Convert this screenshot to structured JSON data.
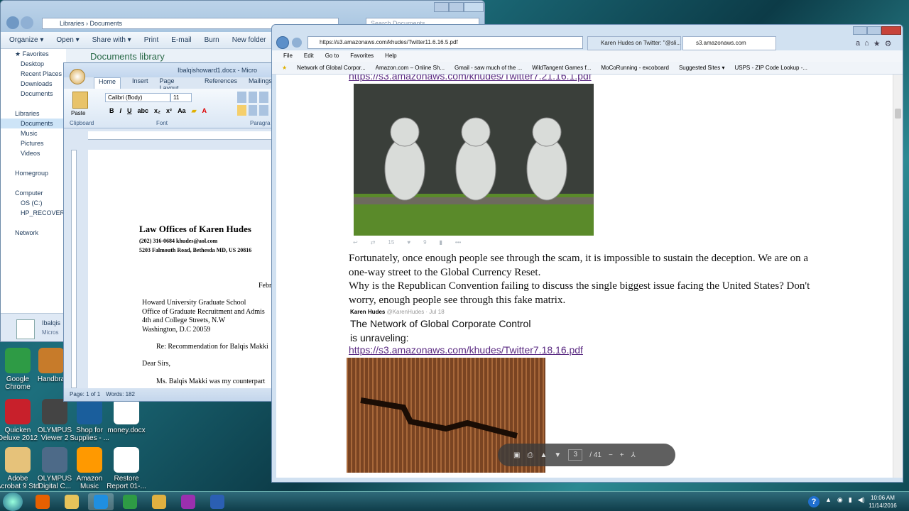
{
  "explorer": {
    "address": "Libraries › Documents",
    "search_placeholder": "Search Documents",
    "commands": [
      "Organize ▾",
      "Open ▾",
      "Share with ▾",
      "Print",
      "E-mail",
      "Burn",
      "New folder"
    ],
    "nav": [
      "★ Favorites",
      "Desktop",
      "Recent Places",
      "Downloads",
      "Documents",
      "",
      "Libraries",
      "Documents",
      "Music",
      "Pictures",
      "Videos",
      "",
      "Homegroup",
      "",
      "Computer",
      "OS (C:)",
      "HP_RECOVERY",
      "",
      "Network"
    ],
    "library_title": "Documents library",
    "details_name": "Ibalqis",
    "details_type": "Micros"
  },
  "word": {
    "title": "Ibalqishoward1.docx - Micro",
    "tabs": [
      "Home",
      "Insert",
      "Page Layout",
      "References",
      "Mailings"
    ],
    "font_name": "Calibri (Body)",
    "font_size": "11",
    "groups": [
      "Clipboard",
      "Font",
      "Paragra"
    ],
    "paste": "Paste",
    "letterhead": "Law Offices of Karen Hudes",
    "phone_line": "(202) 316-0684    khudes@aol.com",
    "address_line": "5203 Falmouth Road, Bethesda MD, US 20816",
    "date": "Febr",
    "recipient": [
      "Howard University Graduate School",
      "Office of Graduate Recruitment and Admis",
      "4th and College Streets, N.W",
      "Washington, D.C 20059"
    ],
    "re": "Re: Recommendation for Balqis Makki",
    "salutation": "Dear Sirs,",
    "body": "Ms. Balqis Makki was my counterpart",
    "status_page": "Page: 1 of 1",
    "status_words": "Words: 182"
  },
  "browser": {
    "url": "https://s3.amazonaws.com/khudes/Twitter11.6.16.5.pdf",
    "tabs": [
      "Karen Hudes on Twitter: \"@sli...",
      "s3.amazonaws.com"
    ],
    "menu": [
      "File",
      "Edit",
      "Go to",
      "Favorites",
      "Help"
    ],
    "favorites": [
      "Network of Global Corpor...",
      "Amazon.com – Online Sh...",
      "Gmail - saw much of the ...",
      "WildTangent Games f...",
      "MoCoRunning - excoboard",
      "Suggested Sites ▾",
      "USPS - ZIP Code Lookup -..."
    ],
    "link_top": "https://s3.amazonaws.com/khudes/Twitter7.21.16.1.pdf",
    "tweet_stats": [
      "15",
      "9"
    ],
    "paragraph1": "Fortunately, once enough people see through the scam, it is impossible to sustain the deception.  We are on a one-way street to the Global Currency Reset.",
    "paragraph2": "Why is the Republican Convention failing to discuss the single biggest issue facing the United States?  Don't worry, enough people see through this fake matrix.",
    "tweet_author": "Karen Hudes",
    "tweet_handle": "@KarenHudes · Jul 18",
    "tweet_line1": "The Network of Global Corporate Control",
    "tweet_line2": "is unraveling:",
    "link_bottom": "https://s3.amazonaws.com/khudes/Twitter7.18.16.pdf",
    "pdf_page": "3",
    "pdf_total": "/ 41"
  },
  "desktop_icons": [
    {
      "label": "Google Chrome",
      "color": "#2e9b45"
    },
    {
      "label": "Handbra",
      "color": "#c77b2a"
    },
    {
      "label": "Quicken Deluxe 2012",
      "color": "#c8202b"
    },
    {
      "label": "OLYMPUS Viewer 2",
      "color": "#444"
    },
    {
      "label": "Shop for Supplies - ...",
      "color": "#1a5e9c"
    },
    {
      "label": "money.docx",
      "color": "#ffffff"
    },
    {
      "label": "Adobe Acrobat 9 Std",
      "color": "#e6c27a"
    },
    {
      "label": "OLYMPUS Digital C...",
      "color": "#4d6a88"
    },
    {
      "label": "Amazon Music",
      "color": "#ff9900"
    },
    {
      "label": "Restore Report 01-...",
      "color": "#ffffff"
    }
  ],
  "taskbar": {
    "time": "10:06 AM",
    "date": "11/14/2016",
    "apps": [
      {
        "name": "firefox-icon",
        "color": "#e66000"
      },
      {
        "name": "folder-icon",
        "color": "#e7c35a"
      },
      {
        "name": "ie-icon",
        "color": "#1f8fe0"
      },
      {
        "name": "chrome-icon",
        "color": "#2e9b45"
      },
      {
        "name": "media-icon",
        "color": "#e0b040"
      },
      {
        "name": "p-app-icon",
        "color": "#9b2fae"
      },
      {
        "name": "word-icon",
        "color": "#2b5fb3"
      }
    ]
  }
}
